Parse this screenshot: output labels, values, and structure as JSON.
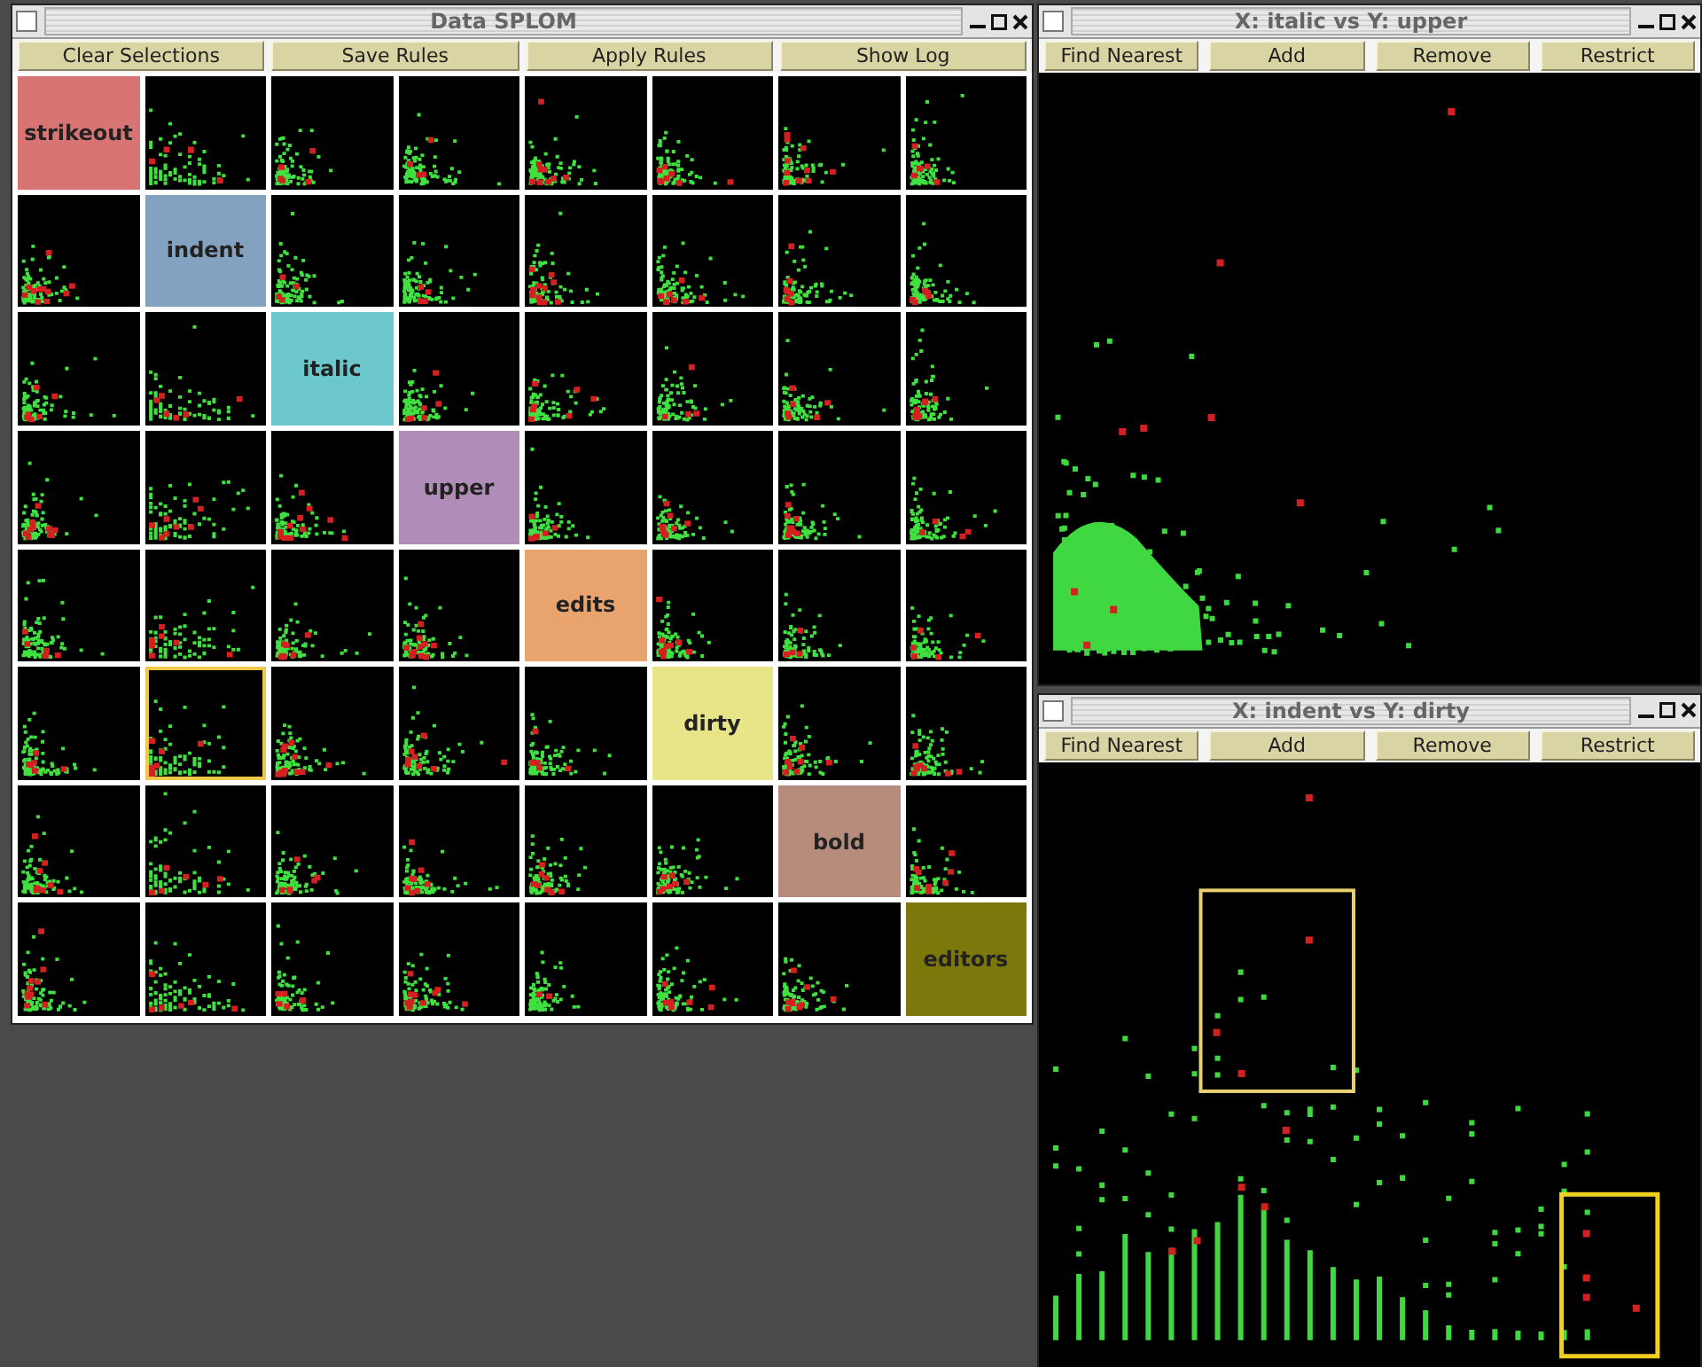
{
  "splom_window": {
    "title": "Data SPLOM",
    "buttons": [
      "Clear Selections",
      "Save Rules",
      "Apply Rules",
      "Show Log"
    ],
    "rows": [
      {
        "label": "strikeout",
        "color": "#d87474",
        "plots": [
          {
            "selected": false
          },
          {
            "selected": false
          },
          {
            "selected": false
          },
          {
            "selected": false
          },
          {
            "selected": false
          },
          {
            "selected": false
          },
          {
            "selected": false
          }
        ]
      },
      {
        "label": "indent",
        "color": "#82a2c0",
        "plots": [
          {
            "selected": false
          },
          {
            "selected": false
          },
          {
            "selected": false
          },
          {
            "selected": false
          },
          {
            "selected": false
          },
          {
            "selected": false
          },
          {
            "selected": false
          }
        ]
      },
      {
        "label": "italic",
        "color": "#6cc8cc",
        "plots": [
          {
            "selected": false
          },
          {
            "selected": false
          },
          {
            "selected": false
          },
          {
            "selected": false
          },
          {
            "selected": false
          },
          {
            "selected": false
          },
          {
            "selected": false
          }
        ]
      },
      {
        "label": "upper",
        "color": "#b08cb8",
        "plots": [
          {
            "selected": false
          },
          {
            "selected": false
          },
          {
            "selected": false
          },
          {
            "selected": false
          },
          {
            "selected": false
          },
          {
            "selected": false
          },
          {
            "selected": false
          }
        ]
      },
      {
        "label": "edits",
        "color": "#e8a46c",
        "plots": [
          {
            "selected": false
          },
          {
            "selected": false
          },
          {
            "selected": false
          },
          {
            "selected": false
          },
          {
            "selected": false
          },
          {
            "selected": false
          },
          {
            "selected": false
          }
        ]
      },
      {
        "label": "dirty",
        "color": "#e8e488",
        "plots": [
          {
            "selected": false
          },
          {
            "selected": true
          },
          {
            "selected": false
          },
          {
            "selected": false
          },
          {
            "selected": false
          },
          {
            "selected": false
          },
          {
            "selected": false
          }
        ]
      },
      {
        "label": "bold",
        "color": "#b88c7c",
        "plots": [
          {
            "selected": false
          },
          {
            "selected": false
          },
          {
            "selected": false
          },
          {
            "selected": false
          },
          {
            "selected": false
          },
          {
            "selected": false
          },
          {
            "selected": false
          }
        ]
      },
      {
        "label": "editors",
        "color": "#7c780c",
        "plots": [
          {
            "selected": false
          },
          {
            "selected": false
          },
          {
            "selected": false
          },
          {
            "selected": false
          },
          {
            "selected": false
          },
          {
            "selected": false
          },
          {
            "selected": false
          }
        ]
      }
    ]
  },
  "plot_windows": [
    {
      "title": "X: italic vs Y: upper",
      "kind": "cluster",
      "buttons": [
        "Find Nearest",
        "Add",
        "Remove",
        "Restrict"
      ]
    },
    {
      "title": "X: indent vs Y: dirty",
      "kind": "bars",
      "buttons": [
        "Find Nearest",
        "Add",
        "Remove",
        "Restrict"
      ]
    }
  ]
}
